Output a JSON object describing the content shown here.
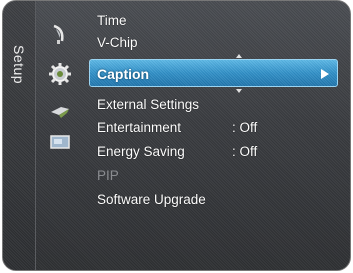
{
  "sidebar": {
    "label": "Setup",
    "icons": [
      "satellite-dish-icon",
      "gear-icon",
      "sound-speaker-icon",
      "tv-screen-icon"
    ]
  },
  "menu": {
    "items": [
      {
        "label": "Time",
        "value": "",
        "state": "normal"
      },
      {
        "label": "V-Chip",
        "value": "",
        "state": "normal"
      },
      {
        "label": "Caption",
        "value": "",
        "state": "selected"
      },
      {
        "label": "External Settings",
        "value": "",
        "state": "normal"
      },
      {
        "label": "Entertainment",
        "value": ": Off",
        "state": "normal"
      },
      {
        "label": "Energy Saving",
        "value": ": Off",
        "state": "normal"
      },
      {
        "label": "PIP",
        "value": "",
        "state": "disabled"
      },
      {
        "label": "Software Upgrade",
        "value": "",
        "state": "normal"
      }
    ]
  },
  "colors": {
    "highlight": "#2f8fc7",
    "text": "#ffffff",
    "disabled_text": "#8a8c90",
    "background": "#3a3c40"
  }
}
